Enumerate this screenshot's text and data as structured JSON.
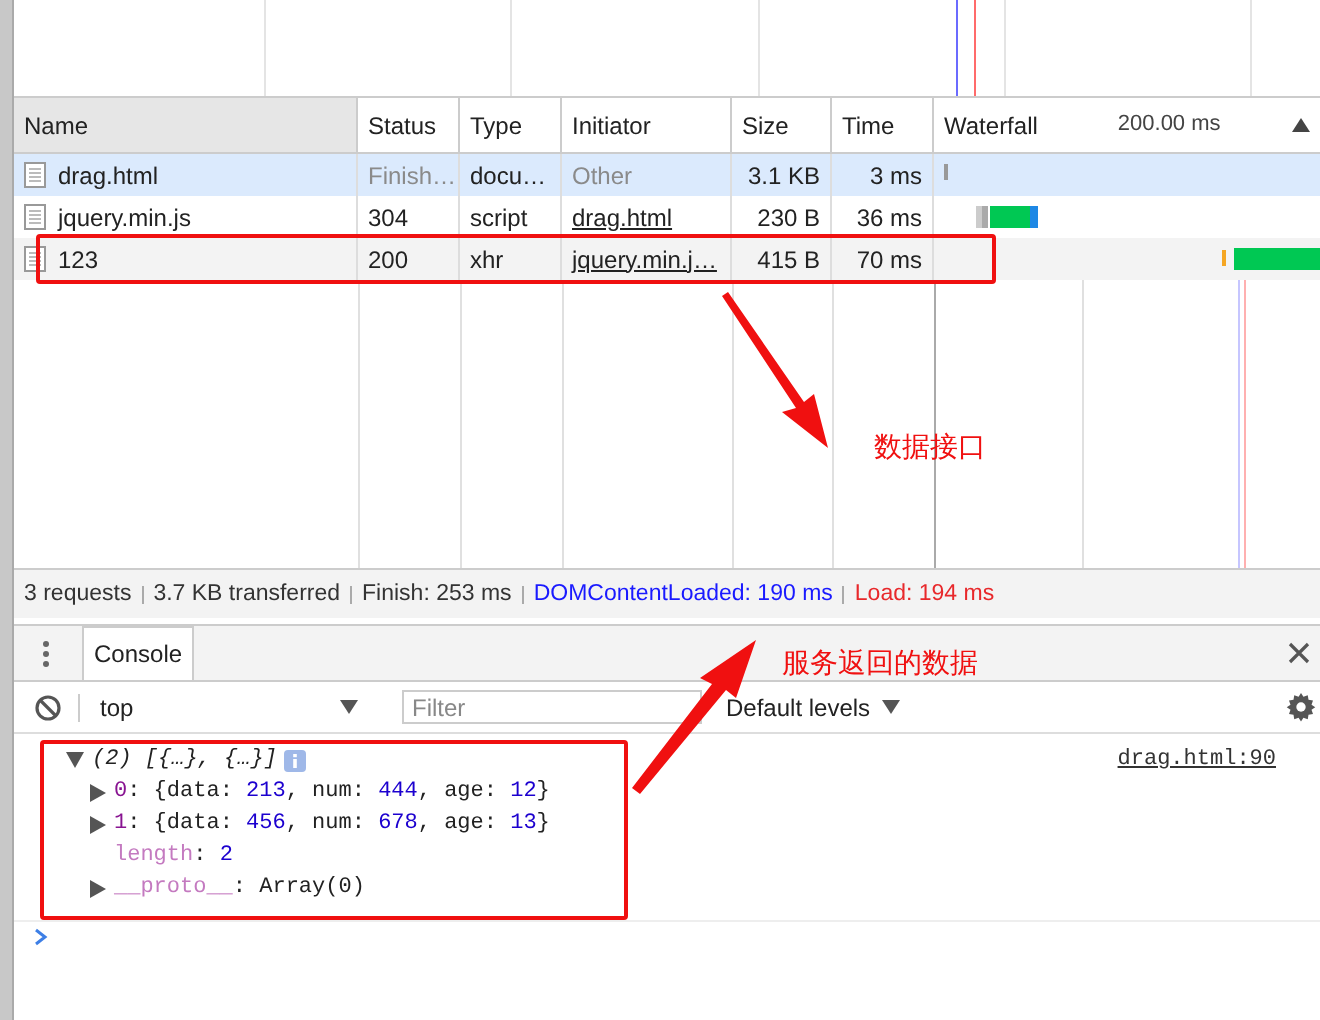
{
  "network": {
    "columns": [
      {
        "label": "Name",
        "sorted": true
      },
      {
        "label": "Status",
        "sorted": false
      },
      {
        "label": "Type",
        "sorted": false
      },
      {
        "label": "Initiator",
        "sorted": false
      },
      {
        "label": "Size",
        "sorted": false
      },
      {
        "label": "Time",
        "sorted": false
      }
    ],
    "waterfall": {
      "label": "Waterfall",
      "scale": "200.00 ms"
    },
    "rows": [
      {
        "name": "drag.html",
        "status": "Finish…",
        "type": "docu…",
        "initiator": "Other",
        "initiator_link": false,
        "dimmed": true,
        "size": "3.1 KB",
        "time": "3 ms",
        "selected": true
      },
      {
        "name": "jquery.min.js",
        "status": "304",
        "type": "script",
        "initiator": "drag.html",
        "initiator_link": true,
        "dimmed": false,
        "size": "230 B",
        "time": "36 ms",
        "selected": false
      },
      {
        "name": "123",
        "status": "200",
        "type": "xhr",
        "initiator": "jquery.min.j…",
        "initiator_link": true,
        "dimmed": false,
        "size": "415 B",
        "time": "70 ms",
        "selected": false
      }
    ],
    "summary": [
      {
        "text": "3 requests",
        "kind": "plain"
      },
      {
        "text": "3.7 KB transferred",
        "kind": "plain"
      },
      {
        "text": "Finish: 253 ms",
        "kind": "plain"
      },
      {
        "text": "DOMContentLoaded: 190 ms",
        "kind": "dom"
      },
      {
        "text": "Load: 194 ms",
        "kind": "load"
      }
    ]
  },
  "drawer": {
    "tabs": [
      {
        "label": "Console",
        "selected": true
      }
    ],
    "context": "top",
    "filter": {
      "placeholder": "Filter"
    },
    "levels": "Default levels"
  },
  "console": {
    "source": "drag.html:90",
    "expanded": true,
    "count": "(2)",
    "preview": "[{…}, {…}]",
    "lines": [
      {
        "kind": "object",
        "expanded": false,
        "parts": [
          {
            "text": "0",
            "kind": "index"
          },
          {
            "text": ": {data: ",
            "kind": "plain"
          },
          {
            "text": "213",
            "kind": "number"
          },
          {
            "text": ", num: ",
            "kind": "plain"
          },
          {
            "text": "444",
            "kind": "number"
          },
          {
            "text": ", age: ",
            "kind": "plain"
          },
          {
            "text": "12",
            "kind": "number"
          },
          {
            "text": "}",
            "kind": "plain"
          }
        ]
      },
      {
        "kind": "object",
        "expanded": false,
        "parts": [
          {
            "text": "1",
            "kind": "index"
          },
          {
            "text": ": {data: ",
            "kind": "plain"
          },
          {
            "text": "456",
            "kind": "number"
          },
          {
            "text": ", num: ",
            "kind": "plain"
          },
          {
            "text": "678",
            "kind": "number"
          },
          {
            "text": ", age: ",
            "kind": "plain"
          },
          {
            "text": "13",
            "kind": "number"
          },
          {
            "text": "}",
            "kind": "plain"
          }
        ]
      },
      {
        "kind": "value",
        "parts": [
          {
            "text": "length",
            "kind": "internal"
          },
          {
            "text": ": ",
            "kind": "plain"
          },
          {
            "text": "2",
            "kind": "number"
          }
        ]
      },
      {
        "kind": "object",
        "expanded": false,
        "parts": [
          {
            "text": "__proto__",
            "kind": "internal"
          },
          {
            "text": ": Array(0)",
            "kind": "plain"
          }
        ]
      }
    ]
  },
  "annotations": [
    {
      "text": "数据接口"
    },
    {
      "text": "服务返回的数据"
    }
  ]
}
